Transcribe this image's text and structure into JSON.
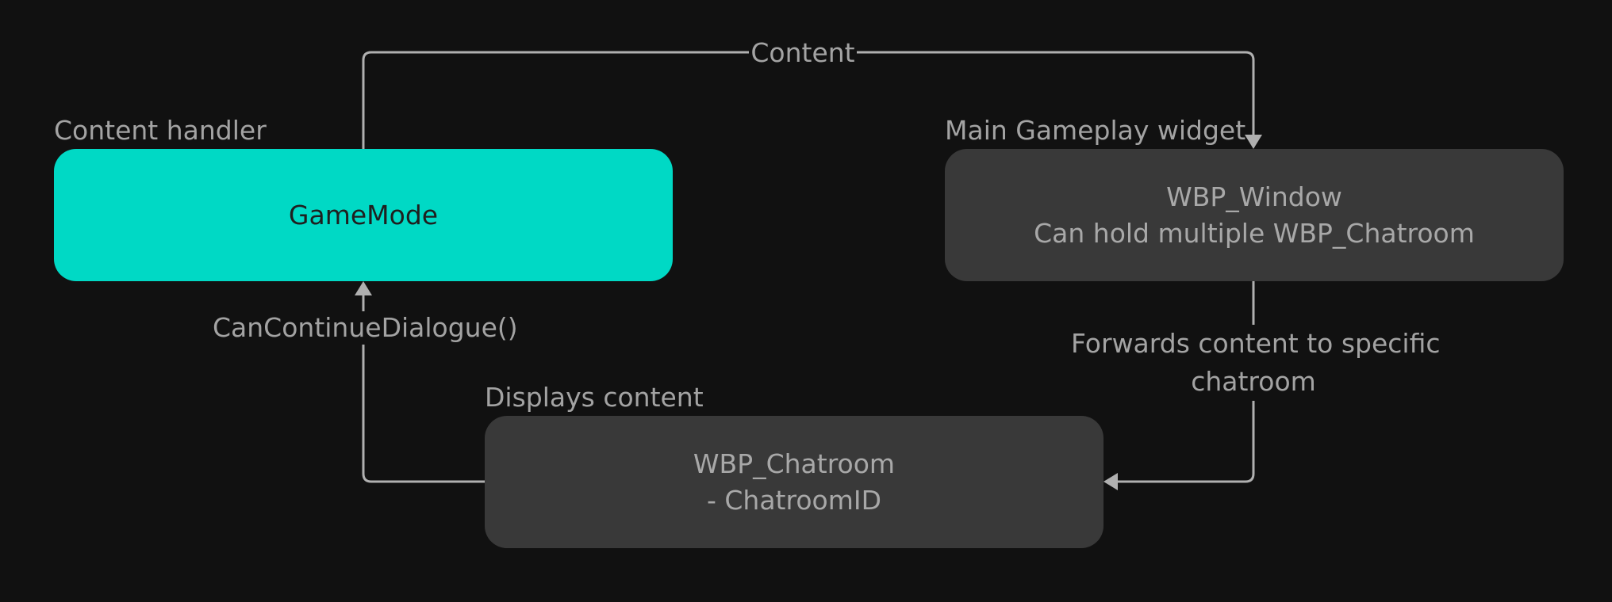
{
  "nodes": {
    "gamemode": {
      "group_label": "Content handler",
      "lines": [
        "GameMode"
      ]
    },
    "window": {
      "group_label": "Main Gameplay widget",
      "lines": [
        "WBP_Window",
        "Can hold multiple WBP_Chatroom"
      ]
    },
    "chatroom": {
      "group_label": "Displays content",
      "lines": [
        "WBP_Chatroom",
        "- ChatroomID"
      ]
    }
  },
  "edges": {
    "content": {
      "label": "Content"
    },
    "forwards": {
      "label_lines": [
        "Forwards content to specific",
        "chatroom"
      ]
    },
    "can_continue": {
      "label": "CanContinueDialogue()"
    }
  },
  "colors": {
    "background": "#111111",
    "accent": "#00d9c5",
    "node_fill": "#393939",
    "text": "#a3a3a3",
    "edge": "#b0b0b0"
  }
}
